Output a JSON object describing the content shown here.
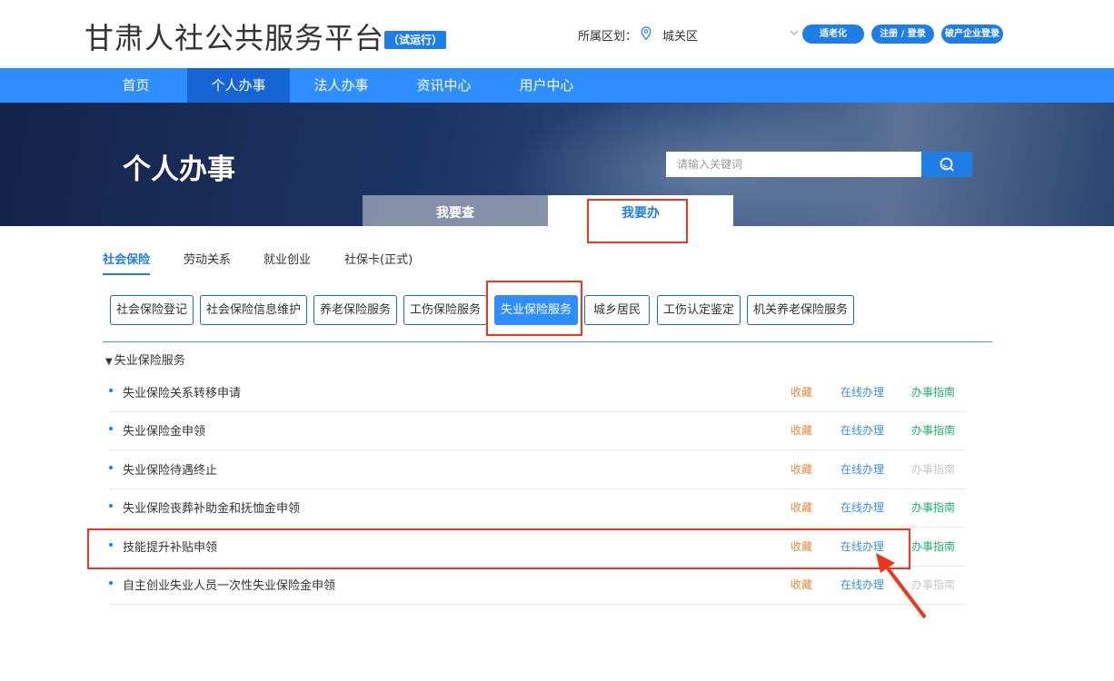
{
  "header": {
    "site_title": "甘肃人社公共服务平台",
    "trial_badge": "（试运行）",
    "region_label": "所属区划：",
    "region_value": "城关区",
    "buttons": {
      "elder": "适老化",
      "login": "注册 / 登录",
      "corp": "破产企业登录"
    }
  },
  "nav": {
    "items": [
      "首页",
      "个人办事",
      "法人办事",
      "资讯中心",
      "用户中心"
    ],
    "active_index": 1
  },
  "banner": {
    "title": "个人办事",
    "search_placeholder": "请输入关键词",
    "tabs": [
      "我要查",
      "我要办"
    ],
    "active_tab_index": 1
  },
  "categories": {
    "items": [
      "社会保险",
      "劳动关系",
      "就业创业",
      "社保卡(正式)"
    ],
    "active_index": 0
  },
  "subcategories": {
    "items": [
      "社会保险登记",
      "社会保险信息维护",
      "养老保险服务",
      "工伤保险服务",
      "失业保险服务",
      "城乡居民",
      "工伤认定鉴定",
      "机关养老保险服务"
    ],
    "active_index": 4
  },
  "section": {
    "title": "失业保险服务"
  },
  "services": [
    {
      "name": "失业保险关系转移申请",
      "fav": "收藏",
      "online": "在线办理",
      "guide": "办事指南",
      "guide_enabled": true
    },
    {
      "name": "失业保险金申领",
      "fav": "收藏",
      "online": "在线办理",
      "guide": "办事指南",
      "guide_enabled": true
    },
    {
      "name": "失业保险待遇终止",
      "fav": "收藏",
      "online": "在线办理",
      "guide": "办事指南",
      "guide_enabled": false
    },
    {
      "name": "失业保险丧葬补助金和抚恤金申领",
      "fav": "收藏",
      "online": "在线办理",
      "guide": "办事指南",
      "guide_enabled": true
    },
    {
      "name": "技能提升补贴申领",
      "fav": "收藏",
      "online": "在线办理",
      "guide": "办事指南",
      "guide_enabled": true
    },
    {
      "name": "自主创业失业人员一次性失业保险金申领",
      "fav": "收藏",
      "online": "在线办理",
      "guide": "办事指南",
      "guide_enabled": false
    }
  ],
  "colors": {
    "primary": "#1f7de8",
    "nav": "#2e8dff",
    "nav_active": "#1565d4",
    "annotation": "#f0351e",
    "fav": "#e8873a",
    "guide": "#22b06c"
  },
  "icons": {
    "region": "location-pin-icon",
    "dropdown": "chevron-down-icon",
    "search": "search-icon",
    "annotation": "arrow-icon"
  }
}
